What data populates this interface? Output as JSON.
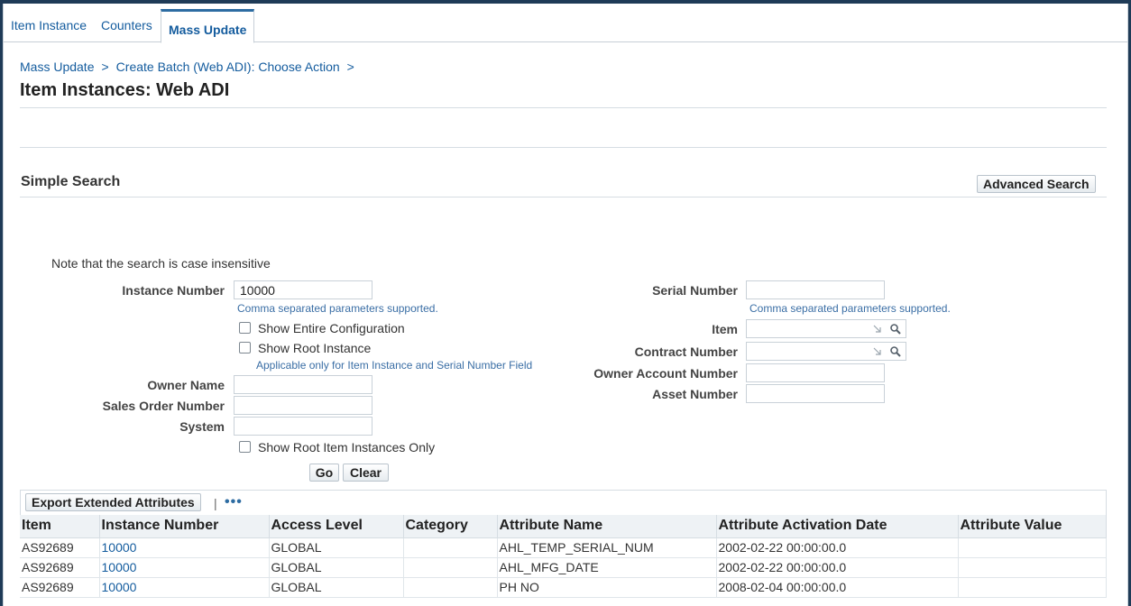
{
  "tabs": [
    {
      "label": "Item Instance"
    },
    {
      "label": "Counters"
    },
    {
      "label": "Mass Update"
    }
  ],
  "breadcrumb": [
    {
      "label": "Mass Update"
    },
    {
      "label": "Create Batch (Web ADI): Choose Action"
    }
  ],
  "breadcrumb_sep": ">",
  "page_title": "Item Instances: Web ADI",
  "search": {
    "title": "Simple Search",
    "advanced_label": "Advanced Search",
    "note": "Note that the search is case insensitive",
    "instance_number_label": "Instance Number",
    "instance_number_value": "10000",
    "comma_hint": "Comma separated parameters supported.",
    "show_entire_config": "Show Entire Configuration",
    "show_root_instance": "Show Root Instance",
    "applicable_hint": "Applicable only for Item Instance and Serial Number Field",
    "owner_name_label": "Owner Name",
    "sales_order_label": "Sales Order Number",
    "system_label": "System",
    "show_root_only": "Show Root Item Instances Only",
    "serial_number_label": "Serial Number",
    "serial_hint": "Comma separated parameters supported.",
    "item_label": "Item",
    "contract_number_label": "Contract Number",
    "owner_account_label": "Owner Account Number",
    "asset_number_label": "Asset Number",
    "go_label": "Go",
    "clear_label": "Clear"
  },
  "results": {
    "export_label": "Export Extended Attributes",
    "pipe": "|",
    "more": "•••",
    "columns": [
      "Item",
      "Instance Number",
      "Access Level",
      "Category",
      "Attribute Name",
      "Attribute Activation Date",
      "Attribute Value"
    ],
    "rows": [
      [
        "AS92689",
        "10000",
        "GLOBAL",
        "",
        "AHL_TEMP_SERIAL_NUM",
        "2002-02-22 00:00:00.0",
        ""
      ],
      [
        "AS92689",
        "10000",
        "GLOBAL",
        "",
        "AHL_MFG_DATE",
        "2002-02-22 00:00:00.0",
        ""
      ],
      [
        "AS92689",
        "10000",
        "GLOBAL",
        "",
        "PH NO",
        "2008-02-04 00:00:00.0",
        ""
      ]
    ]
  }
}
